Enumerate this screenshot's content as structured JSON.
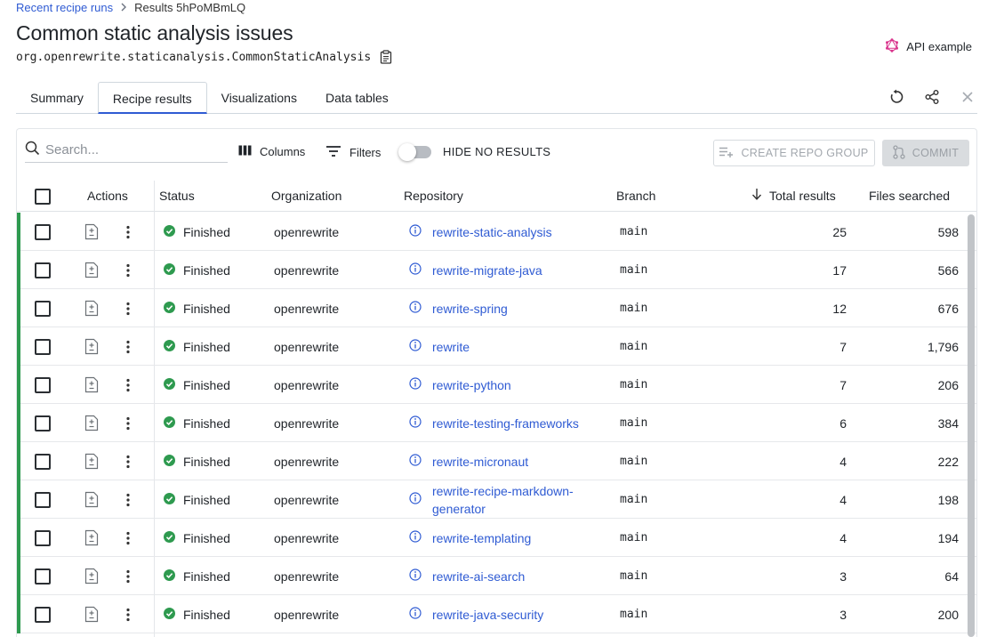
{
  "breadcrumb": {
    "link": "Recent recipe runs",
    "current": "Results 5hPoMBmLQ"
  },
  "page": {
    "title": "Common static analysis issues",
    "recipe_id": "org.openrewrite.staticanalysis.CommonStaticAnalysis",
    "api_example": "API example"
  },
  "tabs": [
    {
      "label": "Summary",
      "active": false
    },
    {
      "label": "Recipe results",
      "active": true
    },
    {
      "label": "Visualizations",
      "active": false
    },
    {
      "label": "Data tables",
      "active": false
    }
  ],
  "toolbar": {
    "search_placeholder": "Search...",
    "columns_label": "Columns",
    "filters_label": "Filters",
    "hide_no_results_label": "HIDE NO RESULTS",
    "hide_no_results_enabled": false,
    "create_repo_group_label": "CREATE REPO GROUP",
    "commit_label": "COMMIT"
  },
  "table": {
    "headers": {
      "actions": "Actions",
      "status": "Status",
      "organization": "Organization",
      "repository": "Repository",
      "branch": "Branch",
      "total_results": "Total results",
      "files_searched": "Files searched"
    },
    "sort_column": "Total results",
    "sort_direction": "descending",
    "rows": [
      {
        "status": "Finished",
        "organization": "openrewrite",
        "repository": "rewrite-static-analysis",
        "branch": "main",
        "total_results": "25",
        "files_searched": "598"
      },
      {
        "status": "Finished",
        "organization": "openrewrite",
        "repository": "rewrite-migrate-java",
        "branch": "main",
        "total_results": "17",
        "files_searched": "566"
      },
      {
        "status": "Finished",
        "organization": "openrewrite",
        "repository": "rewrite-spring",
        "branch": "main",
        "total_results": "12",
        "files_searched": "676"
      },
      {
        "status": "Finished",
        "organization": "openrewrite",
        "repository": "rewrite",
        "branch": "main",
        "total_results": "7",
        "files_searched": "1,796"
      },
      {
        "status": "Finished",
        "organization": "openrewrite",
        "repository": "rewrite-python",
        "branch": "main",
        "total_results": "7",
        "files_searched": "206"
      },
      {
        "status": "Finished",
        "organization": "openrewrite",
        "repository": "rewrite-testing-frameworks",
        "branch": "main",
        "total_results": "6",
        "files_searched": "384"
      },
      {
        "status": "Finished",
        "organization": "openrewrite",
        "repository": "rewrite-micronaut",
        "branch": "main",
        "total_results": "4",
        "files_searched": "222"
      },
      {
        "status": "Finished",
        "organization": "openrewrite",
        "repository": "rewrite-recipe-markdown-generator",
        "branch": "main",
        "total_results": "4",
        "files_searched": "198"
      },
      {
        "status": "Finished",
        "organization": "openrewrite",
        "repository": "rewrite-templating",
        "branch": "main",
        "total_results": "4",
        "files_searched": "194"
      },
      {
        "status": "Finished",
        "organization": "openrewrite",
        "repository": "rewrite-ai-search",
        "branch": "main",
        "total_results": "3",
        "files_searched": "64"
      },
      {
        "status": "Finished",
        "organization": "openrewrite",
        "repository": "rewrite-java-security",
        "branch": "main",
        "total_results": "3",
        "files_searched": "200"
      }
    ]
  },
  "colors": {
    "link": "#2f5bd3",
    "status_success": "#2e9a4f",
    "row_accent": "#2e9a4f",
    "api_icon": "#d9348c"
  },
  "icons": {
    "breadcrumb_sep": "chevron-right-icon",
    "copy": "copy-icon",
    "api": "graphql-icon",
    "refresh": "refresh-icon",
    "share": "share-icon",
    "close": "close-icon",
    "search": "search-icon",
    "columns": "columns-icon",
    "filters": "filter-icon",
    "status": "check-circle-icon",
    "repo_info": "info-icon",
    "diff": "diff-file-icon",
    "row_menu": "kebab-menu-icon",
    "sort": "arrow-down-icon"
  }
}
